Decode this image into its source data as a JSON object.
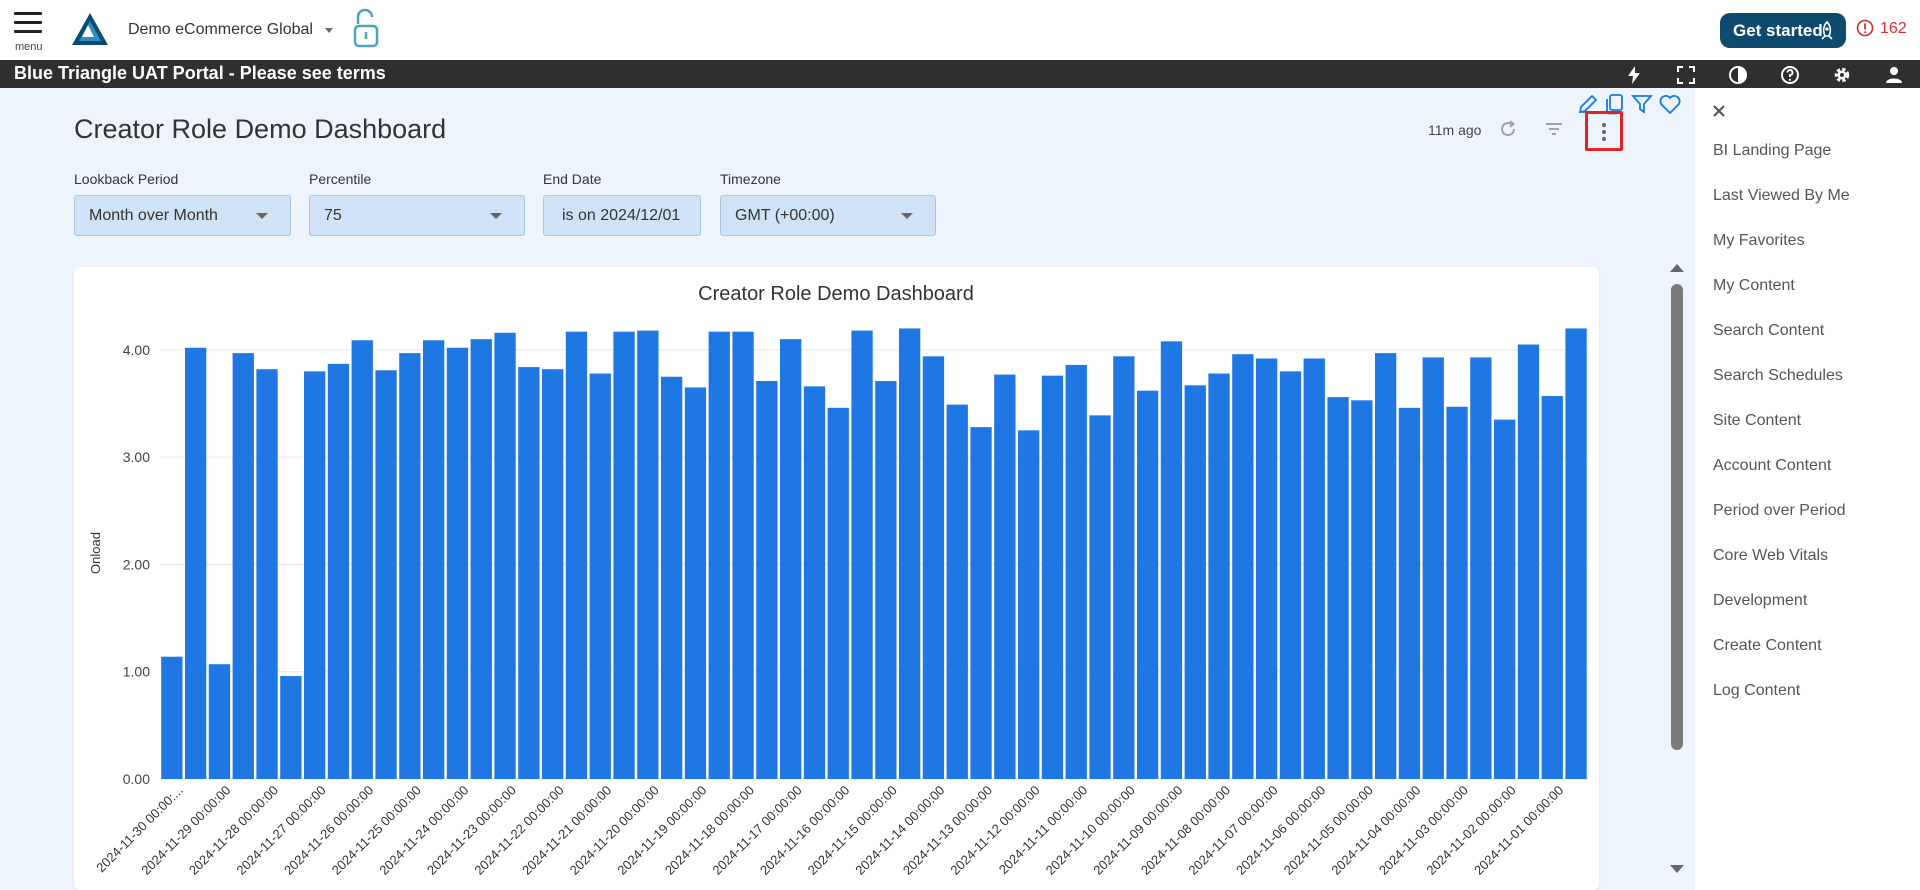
{
  "header": {
    "menu_label": "menu",
    "org_name": "Demo eCommerce Global",
    "get_started_label": "Get started",
    "alert_count": "162",
    "colors": {
      "brand_button": "#0e4a6e",
      "alert": "#d32f2f"
    }
  },
  "banner": {
    "title": "Blue Triangle UAT Portal - Please see terms",
    "icons": [
      "bolt-icon",
      "fullscreen-icon",
      "contrast-icon",
      "help-icon",
      "settings-icon",
      "user-icon"
    ]
  },
  "dashboard": {
    "title": "Creator Role Demo Dashboard",
    "updated": "11m ago",
    "tile_action_icons": [
      "edit-icon",
      "copy-icon",
      "funnel-icon",
      "heart-icon"
    ]
  },
  "filters": [
    {
      "label": "Lookback Period",
      "value": "Month over Month"
    },
    {
      "label": "Percentile",
      "value": "75"
    },
    {
      "label": "End Date",
      "value": "is on 2024/12/01"
    },
    {
      "label": "Timezone",
      "value": "GMT (+00:00)"
    }
  ],
  "side_nav": {
    "items": [
      "BI Landing Page",
      "Last Viewed By Me",
      "My Favorites",
      "My Content",
      "Search Content",
      "Search Schedules",
      "Site Content",
      "Account Content",
      "Period over Period",
      "Core Web Vitals",
      "Development",
      "Create Content",
      "Log Content"
    ]
  },
  "chart_data": {
    "type": "bar",
    "title": "Creator Role Demo Dashboard",
    "ylabel": "Onload",
    "xlabel": "",
    "ylim": [
      0,
      4.4
    ],
    "yticks": [
      "0.00",
      "1.00",
      "2.00",
      "3.00",
      "4.00"
    ],
    "grid": true,
    "color": "#1f77e4",
    "tick_labels": [
      "2024-11-30 00:00:...",
      "2024-11-29 00:00:00",
      "2024-11-28 00:00:00",
      "2024-11-27 00:00:00",
      "2024-11-26 00:00:00",
      "2024-11-25 00:00:00",
      "2024-11-24 00:00:00",
      "2024-11-23 00:00:00",
      "2024-11-22 00:00:00",
      "2024-11-21 00:00:00",
      "2024-11-20 00:00:00",
      "2024-11-19 00:00:00",
      "2024-11-18 00:00:00",
      "2024-11-17 00:00:00",
      "2024-11-16 00:00:00",
      "2024-11-15 00:00:00",
      "2024-11-14 00:00:00",
      "2024-11-13 00:00:00",
      "2024-11-12 00:00:00",
      "2024-11-11 00:00:00",
      "2024-11-10 00:00:00",
      "2024-11-09 00:00:00",
      "2024-11-08 00:00:00",
      "2024-11-07 00:00:00",
      "2024-11-06 00:00:00",
      "2024-11-05 00:00:00",
      "2024-11-04 00:00:00",
      "2024-11-03 00:00:00",
      "2024-11-02 00:00:00",
      "2024-11-01 00:00:00"
    ],
    "values": [
      1.14,
      4.02,
      1.07,
      3.97,
      3.82,
      0.96,
      3.8,
      3.87,
      4.09,
      3.81,
      3.97,
      4.09,
      4.02,
      4.1,
      4.16,
      3.84,
      3.82,
      4.17,
      3.78,
      4.17,
      4.18,
      3.75,
      3.65,
      4.17,
      4.17,
      3.71,
      4.1,
      3.66,
      3.46,
      4.18,
      3.71,
      4.2,
      3.94,
      3.49,
      3.28,
      3.77,
      3.25,
      3.76,
      3.86,
      3.39,
      3.94,
      3.62,
      4.08,
      3.67,
      3.78,
      3.96,
      3.92,
      3.8,
      3.92,
      3.56,
      3.53,
      3.97,
      3.46,
      3.93,
      3.47,
      3.93,
      3.35,
      4.05,
      3.57,
      4.2
    ]
  }
}
